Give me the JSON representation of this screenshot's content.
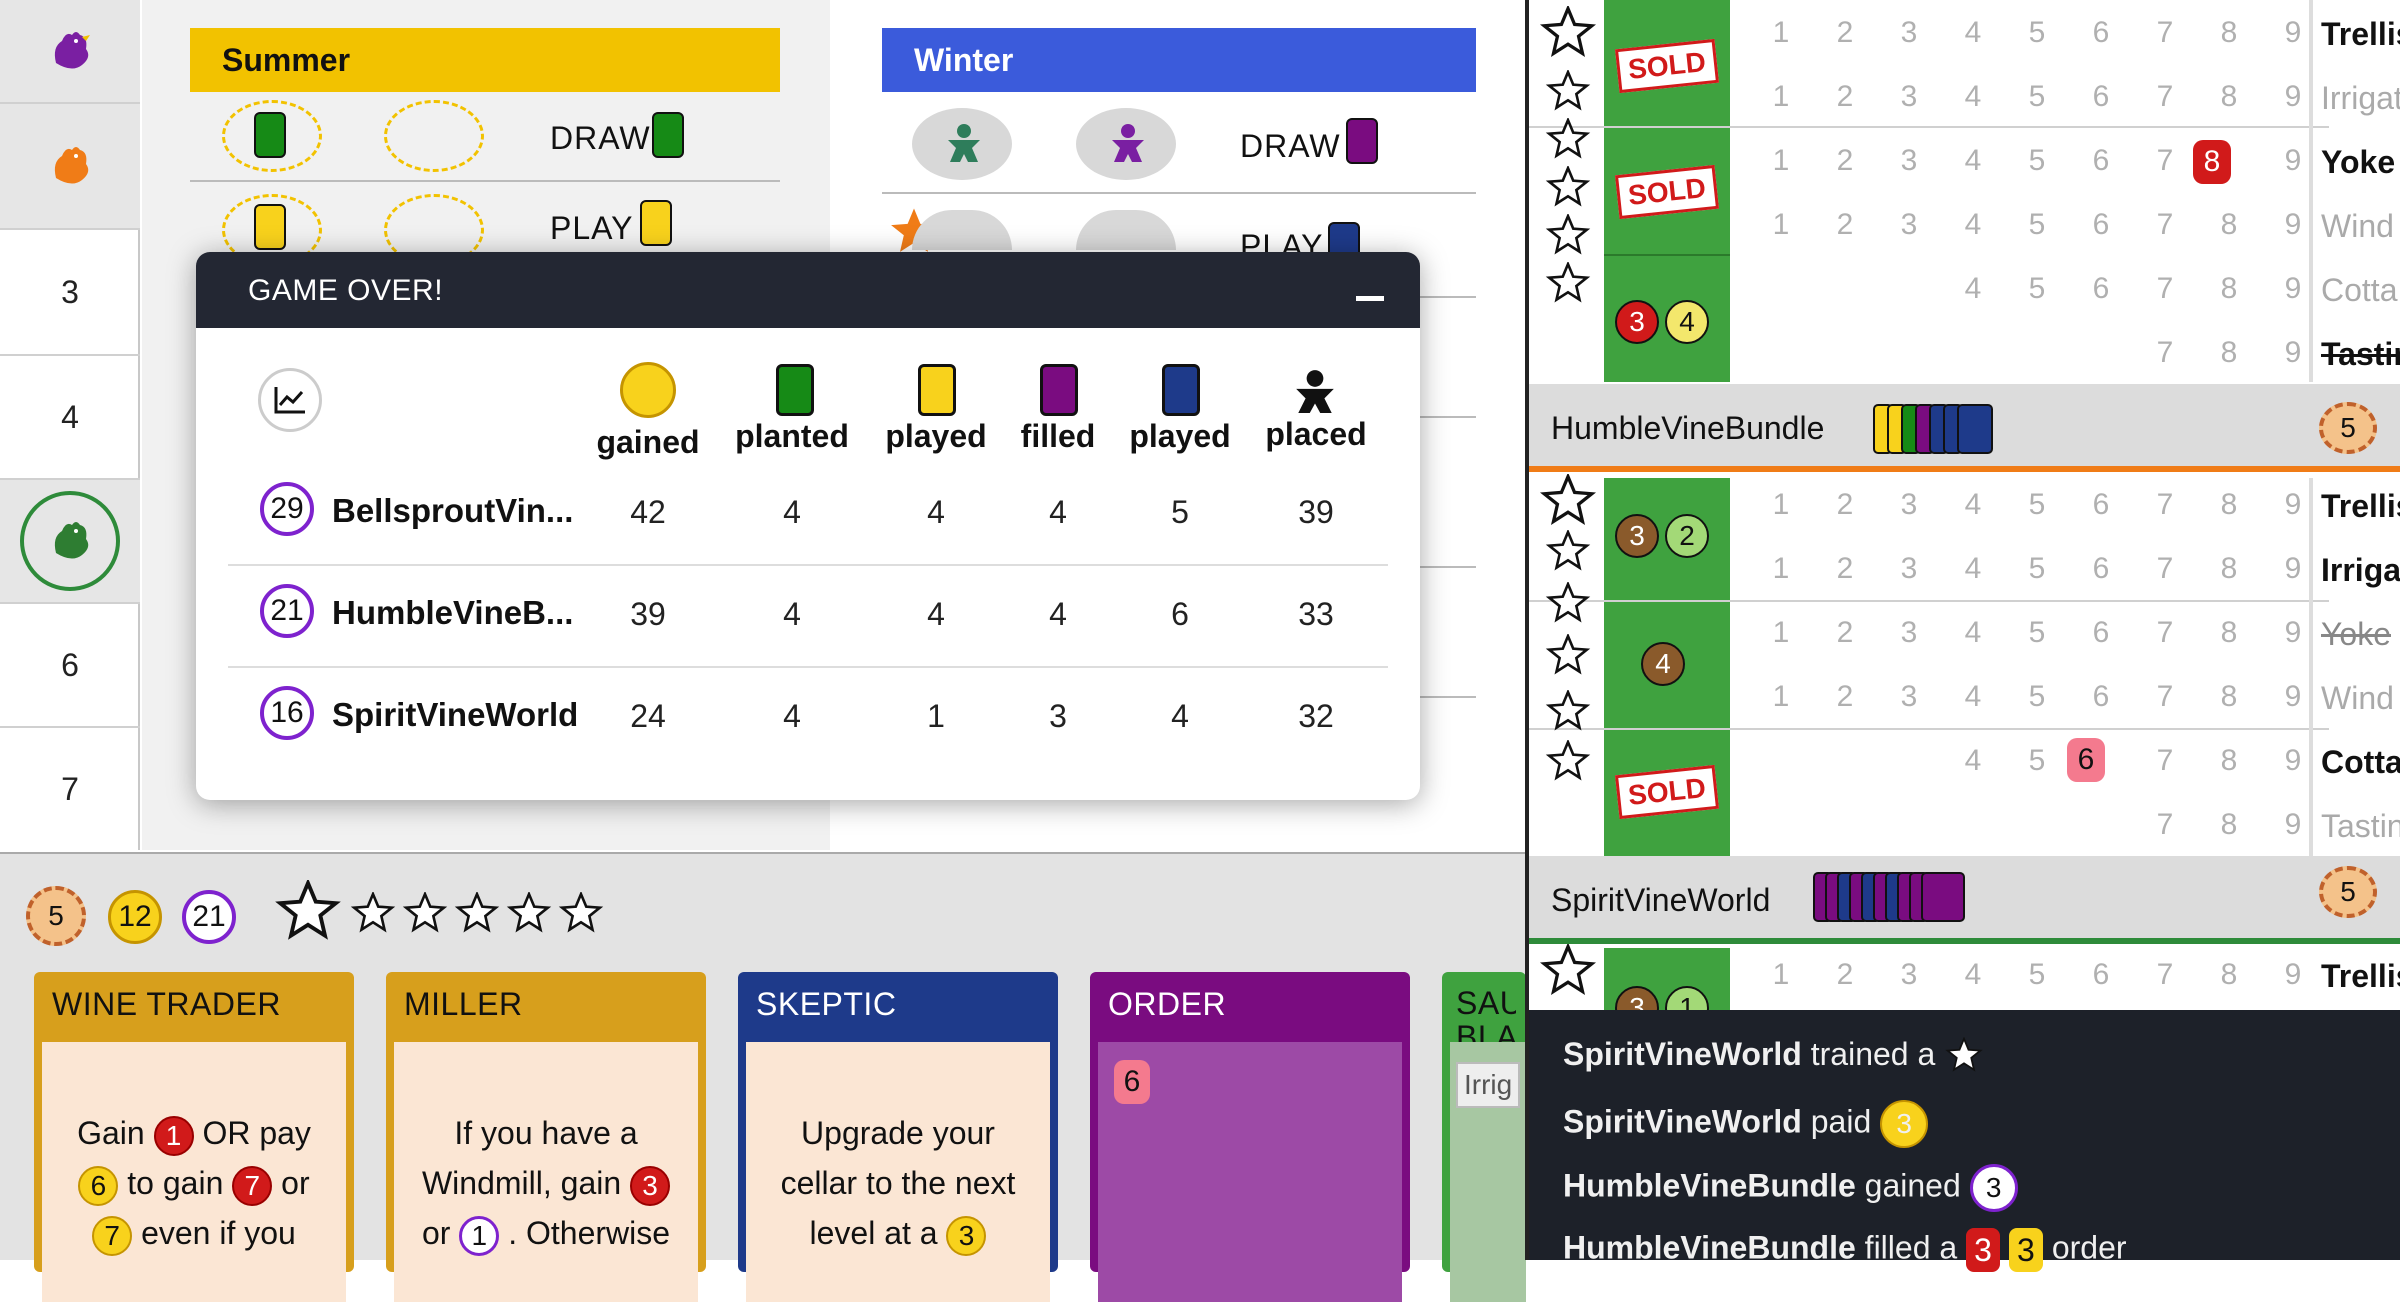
{
  "left_column": {
    "rows": [
      "3",
      "4",
      "6",
      "7"
    ]
  },
  "seasons": {
    "summer": {
      "label": "Summer",
      "draw_label": "DRAW",
      "play_label": "PLAY",
      "color": "#f2c200"
    },
    "winter": {
      "label": "Winter",
      "draw_label": "DRAW",
      "play_label": "PLAY",
      "color": "#3b5bdb"
    }
  },
  "modal": {
    "title": "GAME OVER!",
    "headers": [
      "gained",
      "planted",
      "played",
      "filled",
      "played",
      "placed"
    ],
    "players": [
      {
        "vp": "29",
        "name": "BellsproutVin...",
        "values": [
          "42",
          "4",
          "4",
          "4",
          "5",
          "39"
        ]
      },
      {
        "vp": "21",
        "name": "HumbleVineB...",
        "values": [
          "39",
          "4",
          "4",
          "4",
          "6",
          "33"
        ]
      },
      {
        "vp": "16",
        "name": "SpiritVineWorld",
        "values": [
          "24",
          "4",
          "1",
          "3",
          "4",
          "32"
        ]
      }
    ]
  },
  "status_bar": {
    "residual": "5",
    "coins": "12",
    "vp": "21"
  },
  "cards": [
    {
      "title": "WINE TRADER",
      "color": "#d79f1c",
      "t1": "Gain",
      "i1": "1",
      "t2": "OR pay",
      "i2": "6",
      "t3": "to gain",
      "i3": "7",
      "t4": "or",
      "i4": "7",
      "t5": "even if you"
    },
    {
      "title": "MILLER",
      "color": "#d79f1c",
      "t1": "If you have a",
      "t2": "Windmill, gain",
      "i1": "3",
      "t3": "or",
      "i2": "1",
      "t4": ". Otherwise"
    },
    {
      "title": "SKEPTIC",
      "color": "#1e3a8a",
      "t1": "Upgrade your",
      "t2": "cellar to the next",
      "t3": "level at a",
      "i1": "3"
    },
    {
      "title": "ORDER",
      "color": "#7a0c80",
      "i1": "6"
    },
    {
      "title": "SAU BLA",
      "color": "#3fa23f",
      "chip": "Irrig"
    }
  ],
  "board": {
    "sold_label": "SOLD",
    "numbers": [
      "1",
      "2",
      "3",
      "4",
      "5",
      "6",
      "7",
      "8",
      "9"
    ],
    "section1_structures": [
      "Trellis",
      "Irrigat",
      "Yoke",
      "Wind",
      "Cotta",
      "Tastin"
    ],
    "section1_tokens": [
      "3",
      "4"
    ],
    "section1_highlight": "8",
    "player2": {
      "name": "HumbleVineBundle",
      "residual": "5"
    },
    "section2_structures": [
      "Trellis",
      "Irriga",
      "Yoke",
      "Wind",
      "Cotta",
      "Tastin"
    ],
    "section2_tokens": [
      "3",
      "2",
      "4"
    ],
    "section2_highlight": "6",
    "player3": {
      "name": "SpiritVineWorld",
      "residual": "5"
    },
    "section3_structures": [
      "Trellis"
    ],
    "section3_tokens": [
      "3",
      "1"
    ]
  },
  "log": [
    {
      "player": "SpiritVineWorld",
      "action": "trained a",
      "token": "star"
    },
    {
      "player": "SpiritVineWorld",
      "action": "paid",
      "token": "3"
    },
    {
      "player": "HumbleVineBundle",
      "action": "gained",
      "token": "3"
    },
    {
      "player": "HumbleVineBundle",
      "action": "filled a",
      "token": "3",
      "token2": "3",
      "suffix": "order"
    }
  ]
}
